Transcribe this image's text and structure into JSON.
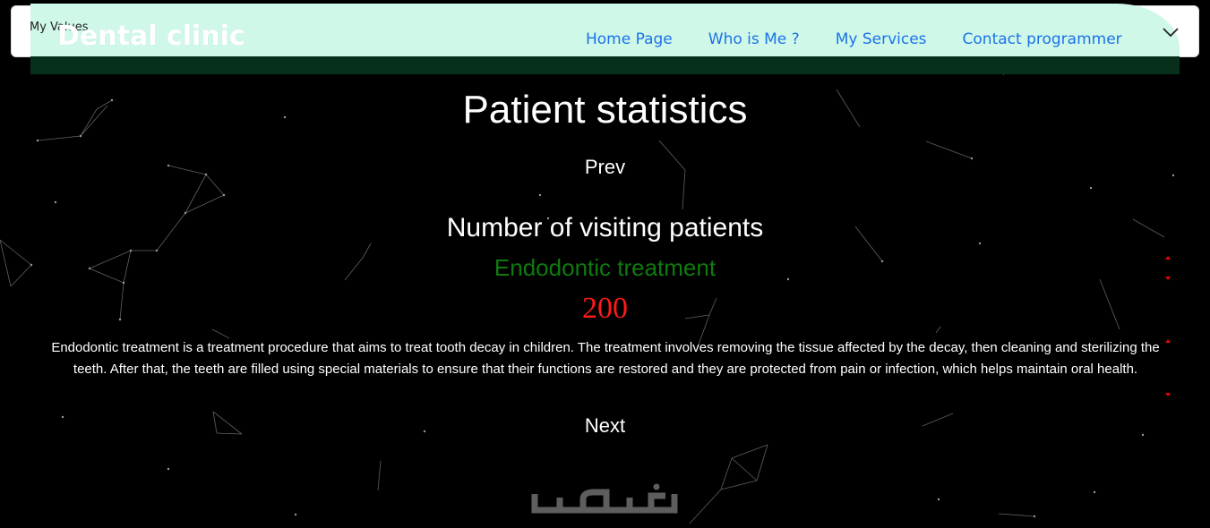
{
  "brand": "Dental clinic",
  "top_label": "My Values",
  "nav": {
    "links": [
      "Home Page",
      "Who is Me ?",
      "My Services",
      "Contact programmer"
    ],
    "toggle_icon": "chevron-down-icon"
  },
  "main": {
    "title": "Patient statistics",
    "prev_label": "Prev",
    "subtitle": "Number of visiting patients",
    "treatment_name": "Endodontic treatment",
    "patient_count": "200",
    "description": "Endodontic treatment is a treatment procedure that aims to treat tooth decay in children. The treatment involves removing the tissue affected by the decay, then cleaning and sterilizing the teeth. After that, the teeth are filled using special materials to ensure that their functions are restored and they are protected from pain or infection, which helps maintain oral health.",
    "next_label": "Next"
  },
  "watermark": "خمسات",
  "colors": {
    "background": "#000000",
    "nav_link": "#1a73e8",
    "treatment": "#0f7a0f",
    "count": "#ff1a1a",
    "nav_green": "#d0f8e8"
  }
}
